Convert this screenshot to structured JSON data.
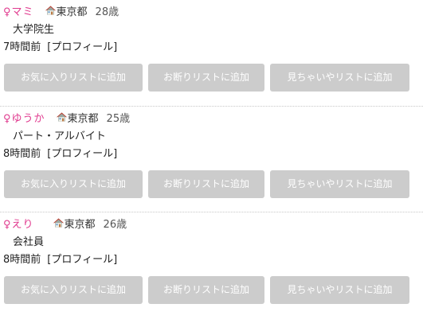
{
  "profiles": [
    {
      "name": "♀マミ",
      "location": "東京都",
      "age": "28歳",
      "occupation": "大学院生",
      "time": "7時間前",
      "profile_link": "[プロフィール]",
      "buttons": {
        "favorite": "お気に入りリストに追加",
        "decline": "お断りリストに追加",
        "seen": "見ちゃいやリストに追加"
      }
    },
    {
      "name": "♀ゆうか",
      "location": "東京都",
      "age": "25歳",
      "occupation": "パート・アルバイト",
      "time": "8時間前",
      "profile_link": "[プロフィール]",
      "buttons": {
        "favorite": "お気に入りリストに追加",
        "decline": "お断りリストに追加",
        "seen": "見ちゃいやリストに追加"
      }
    },
    {
      "name": "♀えり",
      "location": "東京都",
      "age": "26歳",
      "occupation": "会社員",
      "time": "8時間前",
      "profile_link": "[プロフィール]",
      "buttons": {
        "favorite": "お気に入りリストに追加",
        "decline": "お断りリストに追加",
        "seen": "見ちゃいやリストに追加"
      }
    }
  ],
  "icons": {
    "location": "house-icon"
  },
  "colors": {
    "name": "#e0398e",
    "button_bg": "#cccccc",
    "button_text": "#ffffff",
    "divider": "#c8c8c8"
  }
}
